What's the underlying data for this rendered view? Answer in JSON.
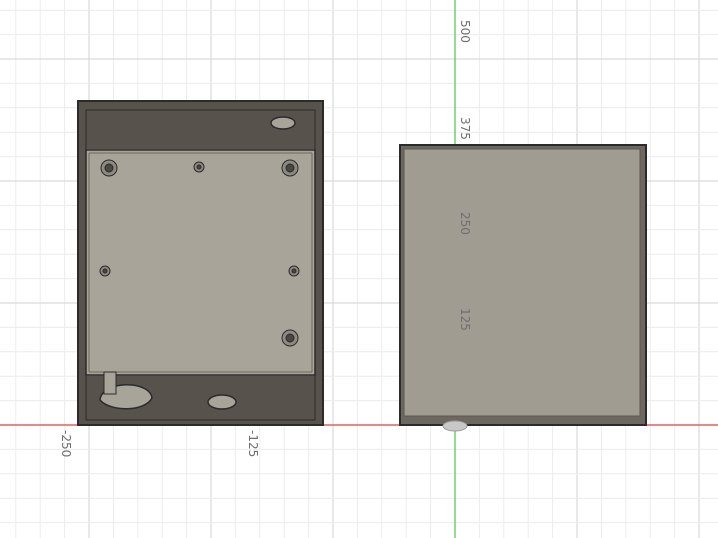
{
  "viewport": {
    "background": "#ffffff",
    "grid_minor_color": "#ececec",
    "grid_major_color": "#d2d2d2",
    "x_axis_color": "#e06060",
    "y_axis_color": "#70d070"
  },
  "axis_labels": {
    "y_500": "500",
    "y_375": "375",
    "y_250": "250",
    "y_125": "125",
    "x_neg250": "-250",
    "x_neg125": "-125"
  },
  "model": {
    "enclosure_base": {
      "part_color": "#a9a49a",
      "wall_color": "#57534c",
      "edge_color": "#2b2b2b"
    },
    "enclosure_lid": {
      "part_color": "#a19c92",
      "edge_color": "#2b2b2b"
    }
  }
}
